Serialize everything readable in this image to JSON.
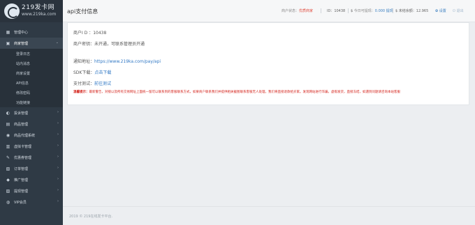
{
  "brand": {
    "title": "219发卡网",
    "subtitle": "www.219ka.com"
  },
  "sidebar": {
    "items": [
      {
        "icon": "dashboard-icon",
        "glyph": "▦",
        "label": "管理中心",
        "has_children": false
      },
      {
        "icon": "store-icon",
        "glyph": "▣",
        "label": "商家管理",
        "has_children": true,
        "expanded": true,
        "children": [
          "登录日志",
          "站内消息",
          "商家设置",
          "API信息",
          "修改密码",
          "功能链接"
        ]
      },
      {
        "icon": "complaint-icon",
        "glyph": "◐",
        "label": "投诉管理",
        "has_children": true
      },
      {
        "icon": "goods-icon",
        "glyph": "▤",
        "label": "商品管理",
        "has_children": true
      },
      {
        "icon": "proxy-icon",
        "glyph": "◉",
        "label": "商品代理系统",
        "has_children": true
      },
      {
        "icon": "card-icon",
        "glyph": "▥",
        "label": "虚拟卡管理",
        "has_children": true
      },
      {
        "icon": "coupon-icon",
        "glyph": "✎",
        "label": "优惠券管理",
        "has_children": true
      },
      {
        "icon": "order-icon",
        "glyph": "▧",
        "label": "订单管理",
        "has_children": true
      },
      {
        "icon": "promo-icon",
        "glyph": "◆",
        "label": "推广管理",
        "has_children": true
      },
      {
        "icon": "withdraw-icon",
        "glyph": "▨",
        "label": "提现管理",
        "has_children": true
      },
      {
        "icon": "vip-icon",
        "glyph": "◍",
        "label": "VIP会员",
        "has_children": true
      }
    ]
  },
  "topbar": {
    "title": "api支付信息",
    "merchant_status_label": "商户状态：",
    "merchant_status_value": "优质商家",
    "id_text": "ID：10438",
    "withdrawable_label": "今日可提现：",
    "withdrawable_value": "0.000",
    "withdraw_link": "提现",
    "unsettled_text": "未结余额：12.965",
    "settings_label": "设置",
    "logout_label": "退出"
  },
  "api_info": {
    "merchant_id_label": "商户I D ：",
    "merchant_id_value": "10438",
    "merchant_key_text": "商户密钥：未开通，可联系管理员开通",
    "notify_label": "通知地址：",
    "notify_url": "https://www.219ka.com/pay/api",
    "sdk_label": "SDK下载：",
    "sdk_link": "点击下载",
    "test_label": "支付测试：",
    "test_link": "前往测试",
    "warning_label": "温馨提示：",
    "warning_text": "最新警告，对接以及所有交易网址上面统一留可以联系到的客服联系方式，如果商户联系我们并提供相关截图联系客服无人处理，我们将直接退款给买家。发现网站进行诈骗，虚假发货，直接冻结，如遇到问题请咨询本站客服"
  },
  "footer": {
    "text": "2019 © 219在线发卡平台."
  },
  "colors": {
    "sidebar_bg": "#2f3a45",
    "status_red": "#e04a3c",
    "link_blue": "#2f77c4",
    "warning_red": "#d4241c"
  }
}
